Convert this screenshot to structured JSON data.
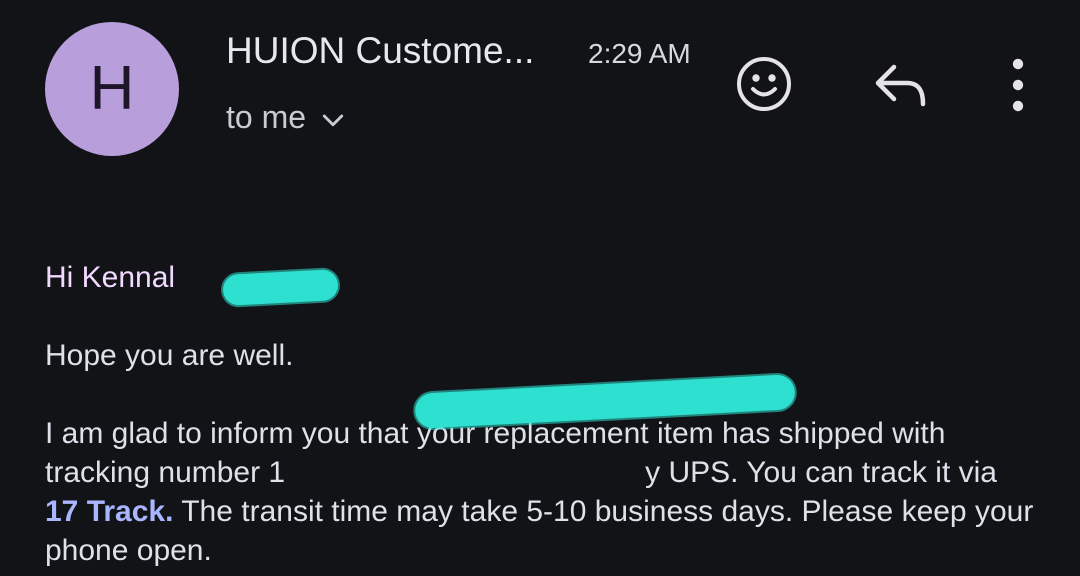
{
  "header": {
    "avatar_letter": "H",
    "sender_name": "HUION Custome...",
    "time": "2:29 AM",
    "recipient_label": "to me",
    "icons": {
      "expand": "chevron-down-icon",
      "emoji": "emoji-reaction-icon",
      "reply": "reply-icon",
      "more": "more-options-icon"
    }
  },
  "message": {
    "greeting": "Hi Kennal",
    "greeting_end": ",",
    "line_1": "Hope you are well.",
    "paragraph_start": "I am glad to inform you that your replacement item has shipped with tracking number 1",
    "paragraph_mid": "y UPS. You can track it via ",
    "link_text": "17 Track.",
    "paragraph_end": " The transit time may take 5-10 business days. Please keep your phone open."
  },
  "colors": {
    "background": "#121317",
    "avatar": "#b89fdb",
    "greeting_text": "#f2d9ff",
    "link": "#a9b6ff",
    "redaction": "#2de0cf"
  }
}
